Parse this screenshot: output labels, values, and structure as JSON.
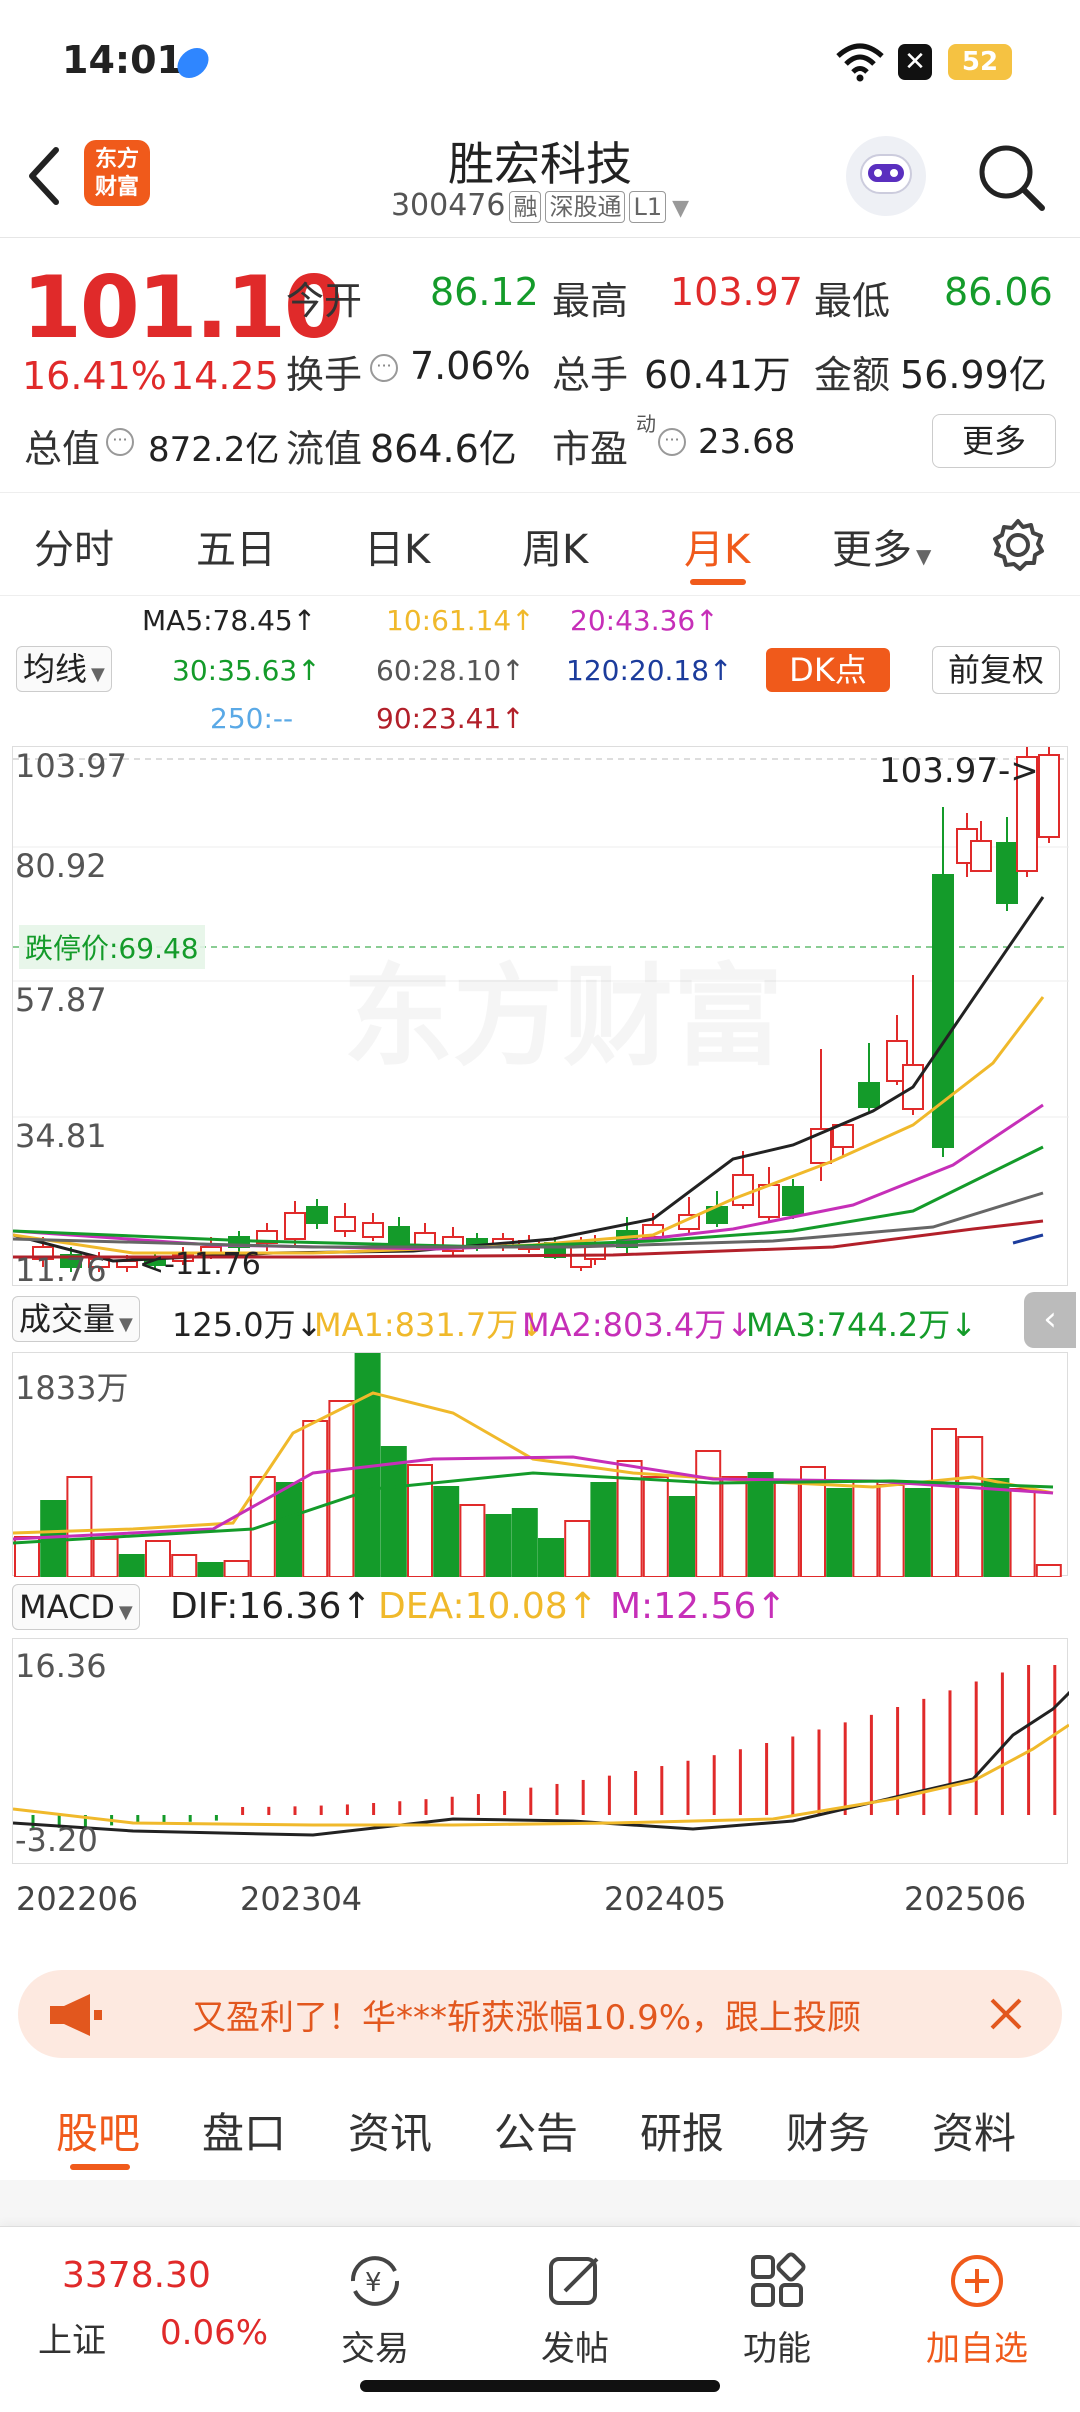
{
  "status": {
    "time": "14:01",
    "battery": "52"
  },
  "header": {
    "logo": "东方\n财富",
    "title": "胜宏科技",
    "code": "300476",
    "tags": [
      "融",
      "深股通",
      "L1"
    ]
  },
  "quote": {
    "price": "101.10",
    "change_pct": "16.41%",
    "change": "14.25",
    "open_label": "今开",
    "open": "86.12",
    "high_label": "最高",
    "high": "103.97",
    "low_label": "最低",
    "low": "86.06",
    "turnover_label": "换手",
    "turnover": "7.06%",
    "volume_label": "总手",
    "volume": "60.41万",
    "amount_label": "金额",
    "amount": "56.99亿",
    "mcap_label": "总值",
    "mcap": "872.2亿",
    "float_label": "流值",
    "float": "864.6亿",
    "pe_label": "市盈",
    "pe_sup": "动",
    "pe": "23.68",
    "more": "更多"
  },
  "ktabs": [
    "分时",
    "五日",
    "日K",
    "周K",
    "月K",
    "更多"
  ],
  "ma": {
    "selector": "均线",
    "ma5": "MA5:78.45↑",
    "ma10": "10:61.14↑",
    "ma20": "20:43.36↑",
    "ma30": "30:35.63↑",
    "ma60": "60:28.10↑",
    "ma120": "120:20.18↑",
    "ma250": "250:--",
    "ma90": "90:23.41↑",
    "dk": "DK点",
    "fq": "前复权"
  },
  "kchart": {
    "y_labels": [
      "103.97",
      "80.92",
      "57.87",
      "34.81",
      "11.76"
    ],
    "high_marker": "103.97->",
    "limit_label": "跌停价:69.48",
    "low_marker": "<-11.76",
    "watermark": "东方财富",
    "colors": {
      "up": "#e02a2a",
      "down": "#149b2a",
      "ma5": "#222222",
      "ma10": "#f0b92b",
      "ma20": "#c62fb8",
      "ma30": "#149b2a",
      "ma60": "#666666",
      "ma120": "#1c3c9c",
      "ma90": "#b2202a"
    }
  },
  "volume": {
    "selector": "成交量",
    "value": "125.0万↓",
    "ma1": "MA1:831.7万↓",
    "ma2": "MA2:803.4万↓",
    "ma3": "MA3:744.2万↓",
    "y_label": "1833万"
  },
  "macd": {
    "selector": "MACD",
    "dif": "DIF:16.36↑",
    "dea": "DEA:10.08↑",
    "m": "M:12.56↑",
    "y_top": "16.36",
    "y_bottom": "-3.20"
  },
  "x_labels": [
    "202206",
    "202304",
    "202405",
    "202506"
  ],
  "promo": {
    "text": "又盈利了！华***斩获涨幅10.9%，跟上投顾"
  },
  "btabs": [
    "股吧",
    "盘口",
    "资讯",
    "公告",
    "研报",
    "财务",
    "资料"
  ],
  "bnav": {
    "index_value": "3378.30",
    "index_name": "上证",
    "index_change": "0.06%",
    "items": [
      "交易",
      "发帖",
      "功能",
      "加自选"
    ]
  }
}
